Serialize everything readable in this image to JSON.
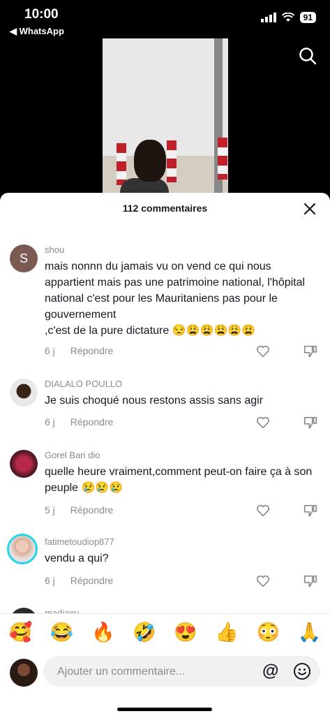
{
  "status": {
    "time": "10:00",
    "back_label": "◀ WhatsApp",
    "battery": "91"
  },
  "sheet": {
    "title": "112 commentaires"
  },
  "comments": [
    {
      "user": "shou",
      "avatar_letter": "S",
      "text": "mais nonnn du jamais vu on vend ce qui nous appartient mais pas une patrimoine national, l'hôpital national c'est pour les Mauritaniens pas pour le gouvernement\n,c'est de la pure dictature 😒😩😩😩😩😩",
      "time": "6 j",
      "reply": "Répondre"
    },
    {
      "user": "DIALALO POULLO",
      "text": "Je suis choqué nous restons assis sans agir",
      "time": "6 j",
      "reply": "Répondre"
    },
    {
      "user": "Gorel Bari dio",
      "text": "quelle heure vraiment,comment peut-on faire ça à son peuple 😢😢😢",
      "time": "5 j",
      "reply": "Répondre"
    },
    {
      "user": "fatimetoudiop877",
      "text": "vendu a qui?",
      "time": "6 j",
      "reply": "Répondre"
    },
    {
      "user": "madiany"
    }
  ],
  "emojis": [
    "🥰",
    "😂",
    "🔥",
    "🤣",
    "😍",
    "👍",
    "😳",
    "🙏"
  ],
  "composer": {
    "placeholder": "Ajouter un commentaire...",
    "at": "@"
  }
}
